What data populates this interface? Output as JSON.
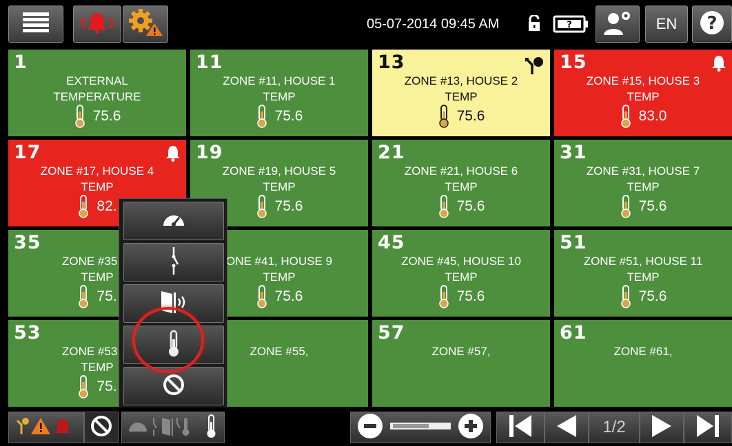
{
  "header": {
    "datetime": "05-07-2014 09:45 AM",
    "language": "EN",
    "icons": {
      "menu": "hamburger-menu-icon",
      "alarm": "alarm-bell-icon",
      "settings_warning": "gear-warning-icon",
      "lock": "unlocked-padlock-icon",
      "battery": "battery-unknown-icon",
      "user_settings": "user-settings-icon",
      "help": "help-question-icon"
    }
  },
  "tiles": [
    {
      "number": "1",
      "name": "EXTERNAL",
      "type": "TEMPERATURE",
      "value": "75.6",
      "state": "ok"
    },
    {
      "number": "11",
      "name": "ZONE #11, HOUSE 1",
      "type": "TEMP",
      "value": "75.6",
      "state": "ok"
    },
    {
      "number": "13",
      "name": "ZONE #13, HOUSE 2",
      "type": "TEMP",
      "value": "75.6",
      "state": "warn"
    },
    {
      "number": "15",
      "name": "ZONE #15, HOUSE 3",
      "type": "TEMP",
      "value": "83.0",
      "state": "alarm"
    },
    {
      "number": "17",
      "name": "ZONE #17, HOUSE 4",
      "type": "TEMP",
      "value": "82.",
      "state": "alarm"
    },
    {
      "number": "19",
      "name": "ZONE #19, HOUSE 5",
      "type": "TEMP",
      "value": "75.6",
      "state": "ok"
    },
    {
      "number": "21",
      "name": "ZONE #21, HOUSE 6",
      "type": "TEMP",
      "value": "75.6",
      "state": "ok"
    },
    {
      "number": "31",
      "name": "ZONE #31, HOUSE 7",
      "type": "TEMP",
      "value": "75.6",
      "state": "ok"
    },
    {
      "number": "35",
      "name": "ZONE #35, H",
      "type": "TEMP",
      "value": "75.",
      "state": "ok"
    },
    {
      "number": "",
      "name": "ONE #41, HOUSE 9",
      "type": "TEMP",
      "value": "75.6",
      "state": "ok"
    },
    {
      "number": "45",
      "name": "ZONE #45, HOUSE 10",
      "type": "TEMP",
      "value": "75.6",
      "state": "ok"
    },
    {
      "number": "51",
      "name": "ZONE #51, HOUSE 11",
      "type": "TEMP",
      "value": "75.6",
      "state": "ok"
    },
    {
      "number": "53",
      "name": "ZONE #53, H",
      "type": "TEMP",
      "value": "75.",
      "state": "ok"
    },
    {
      "number": "",
      "name": "ZONE #55,",
      "type": "",
      "value": "",
      "state": "ok"
    },
    {
      "number": "57",
      "name": "ZONE #57,",
      "type": "",
      "value": "",
      "state": "ok"
    },
    {
      "number": "61",
      "name": "ZONE #61,",
      "type": "",
      "value": "",
      "state": "ok"
    }
  ],
  "popup_menu": {
    "items": [
      {
        "name": "gauge-filter-icon"
      },
      {
        "name": "switch-contact-filter-icon"
      },
      {
        "name": "door-sensor-filter-icon"
      },
      {
        "name": "thermometer-filter-icon",
        "highlighted": true
      },
      {
        "name": "none-filter-icon"
      }
    ]
  },
  "footer": {
    "page_indicator": "1/2",
    "icons": {
      "status_filter": "bypass-warning-alarm-icon",
      "no_filter": "no-filter-icon",
      "type_filter": "sensor-type-filter-icon",
      "zoom_out": "zoom-out-icon",
      "zoom_in": "zoom-in-icon",
      "first": "first-page-icon",
      "prev": "previous-page-icon",
      "next": "next-page-icon",
      "last": "last-page-icon"
    }
  },
  "colors": {
    "ok": "#4d8f3d",
    "warn": "#f9f29a",
    "alarm": "#e8241f",
    "ring": "#dd2222"
  }
}
